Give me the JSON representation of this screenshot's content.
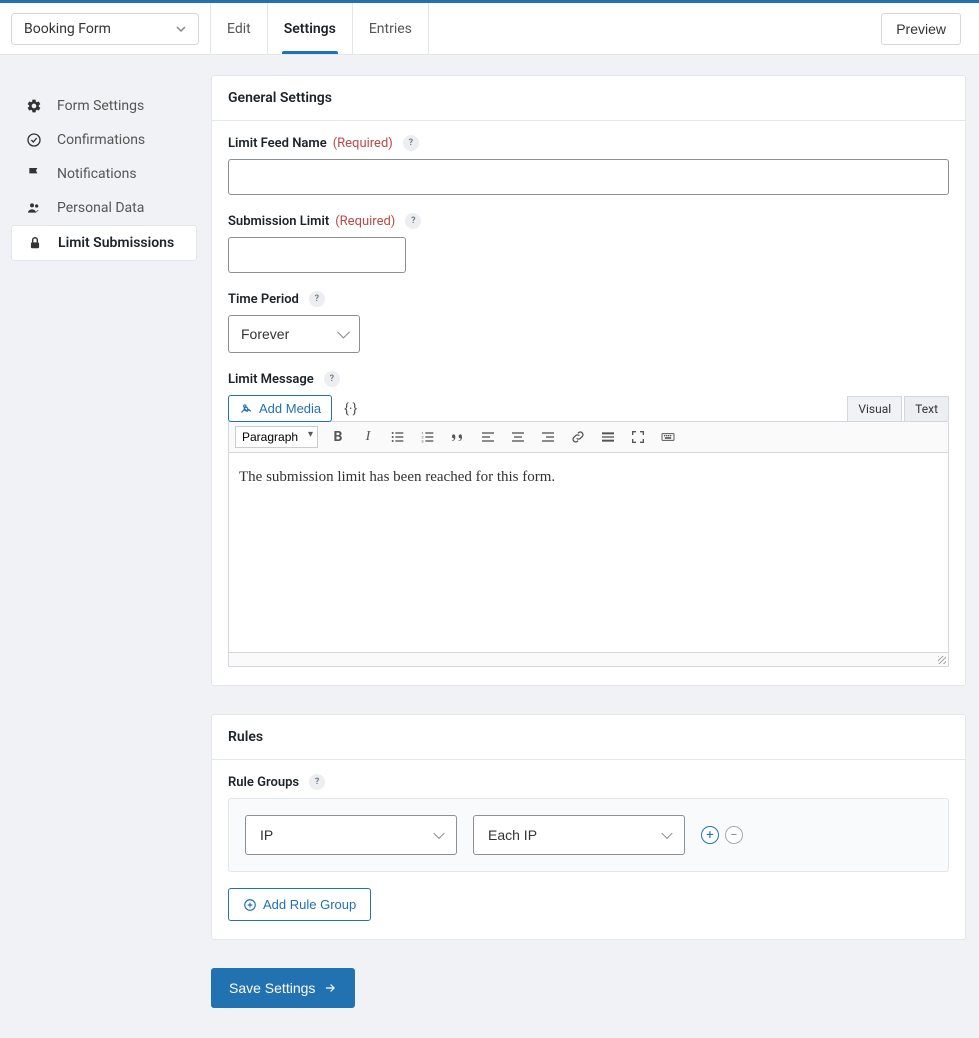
{
  "header": {
    "form_name": "Booking Form",
    "tabs": [
      "Edit",
      "Settings",
      "Entries"
    ],
    "active_tab": "Settings",
    "preview": "Preview"
  },
  "sidenav": {
    "items": [
      {
        "label": "Form Settings",
        "icon": "gear"
      },
      {
        "label": "Confirmations",
        "icon": "check-circle"
      },
      {
        "label": "Notifications",
        "icon": "flag"
      },
      {
        "label": "Personal Data",
        "icon": "users"
      },
      {
        "label": "Limit Submissions",
        "icon": "lock"
      }
    ],
    "active": "Limit Submissions"
  },
  "general": {
    "title": "General Settings",
    "feed_name_label": "Limit Feed Name",
    "feed_name_value": "",
    "submission_limit_label": "Submission Limit",
    "submission_limit_value": "",
    "required": "(Required)",
    "time_period_label": "Time Period",
    "time_period_value": "Forever",
    "limit_message_label": "Limit Message",
    "add_media": "Add Media",
    "editor_tabs": {
      "visual": "Visual",
      "text": "Text"
    },
    "format_select": "Paragraph",
    "editor_content": "The submission limit has been reached for this form."
  },
  "rules": {
    "title": "Rules",
    "groups_label": "Rule Groups",
    "rule_field": "IP",
    "rule_match": "Each IP",
    "add_group": "Add Rule Group"
  },
  "save": "Save Settings"
}
